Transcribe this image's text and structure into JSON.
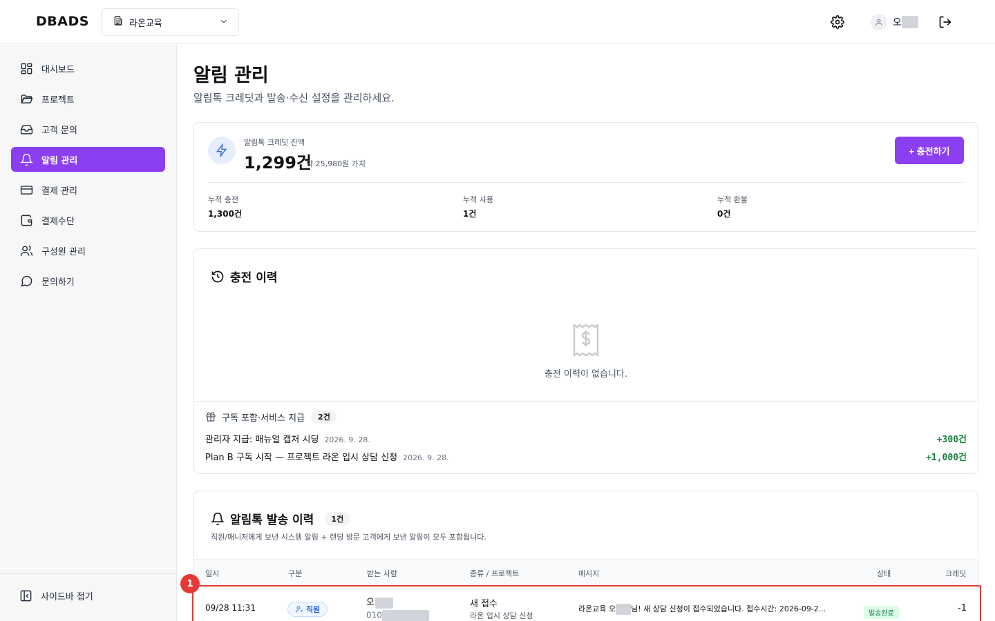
{
  "header": {
    "logo": "DBADS",
    "org_name": "라온교육",
    "user_name_visible": "오"
  },
  "sidebar": {
    "items": [
      {
        "label": "대시보드",
        "icon": "grid-icon"
      },
      {
        "label": "프로젝트",
        "icon": "folder-icon"
      },
      {
        "label": "고객 문의",
        "icon": "inbox-icon"
      },
      {
        "label": "알림 관리",
        "icon": "bell-icon",
        "active": true
      },
      {
        "label": "결제 관리",
        "icon": "credit-card-icon"
      },
      {
        "label": "결제수단",
        "icon": "wallet-icon"
      },
      {
        "label": "구성원 관리",
        "icon": "users-icon"
      },
      {
        "label": "문의하기",
        "icon": "chat-icon"
      }
    ],
    "collapse_label": "사이드바 접기"
  },
  "page": {
    "title": "알림 관리",
    "subtitle": "알림톡 크레딧과 발송·수신 설정을 관리하세요."
  },
  "credit": {
    "label": "알림톡 크레딧 잔액",
    "balance": "1,299건",
    "approx": "약 25,980원 가치",
    "charge_button": "+ 충전하기",
    "stats": [
      {
        "label": "누적 충전",
        "value": "1,300건"
      },
      {
        "label": "누적 사용",
        "value": "1건"
      },
      {
        "label": "누적 환불",
        "value": "0건"
      }
    ]
  },
  "charge_history": {
    "title": "충전 이력",
    "empty_text": "충전 이력이 없습니다.",
    "grant_title": "구독 포함·서비스 지급",
    "grant_count": "2건",
    "grants": [
      {
        "desc": "관리자 지급: 매뉴얼 캡처 시딩",
        "date": "2026. 9. 28.",
        "amount": "+300건"
      },
      {
        "desc": "Plan B 구독 시작 — 프로젝트 라온 입시 상담 신청",
        "date": "2026. 9. 28.",
        "amount": "+1,000건"
      }
    ]
  },
  "send_history": {
    "title": "알림톡 발송 이력",
    "count": "1건",
    "description": "직원/매니저에게 보낸 시스템 알림 + 랜딩 방문 고객에게 보낸 알림이 모두 포함됩니다.",
    "columns": [
      "일시",
      "구분",
      "받는 사람",
      "종류 / 프로젝트",
      "메시지",
      "상태",
      "크레딧"
    ],
    "rows": [
      {
        "datetime": "09/28 11:31",
        "category": "직원",
        "recipient_name": "오",
        "recipient_phone": "010",
        "type": "새 접수",
        "project": "라온 입시 상담 신청",
        "message_a": "라온교육 오",
        "message_b": "님! 새 상담 신청이 접수되었습니다. 접수시간: 2026-09-2...",
        "status": "발송완료",
        "credit": "-1"
      }
    ]
  },
  "annotation_marker": "1",
  "colors": {
    "accent": "#8b3ff0",
    "positive": "#15803d",
    "highlight": "#e53935"
  }
}
